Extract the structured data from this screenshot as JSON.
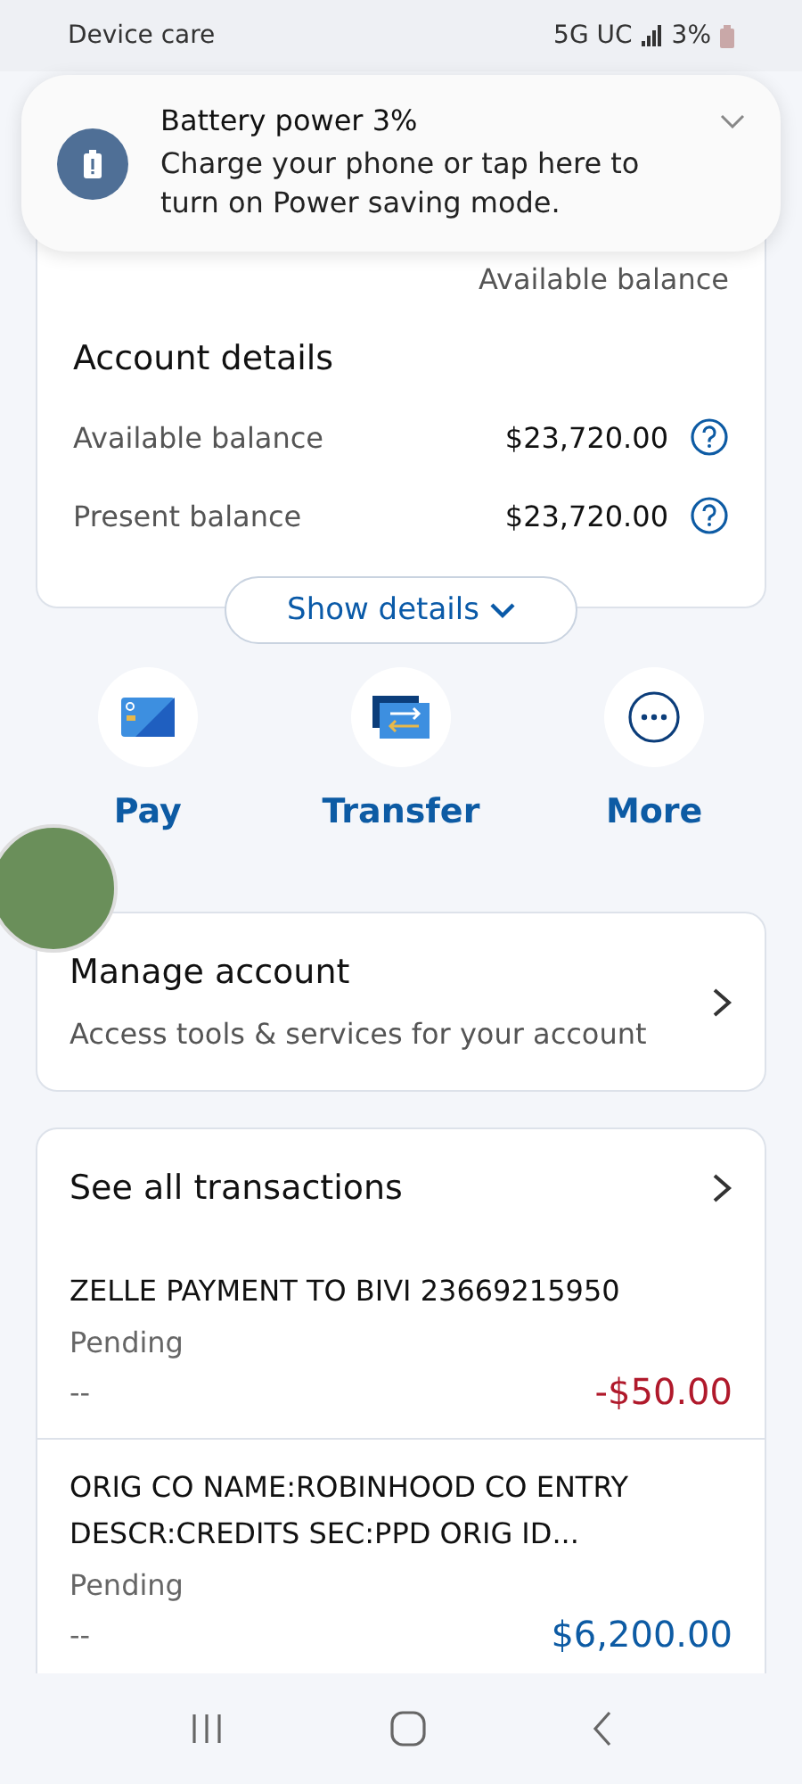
{
  "status_bar": {
    "left": "Device care",
    "network": "5G UC",
    "battery": "3%"
  },
  "notification": {
    "title": "Battery power 3%",
    "message": "Charge your phone or tap here to turn on Power saving mode."
  },
  "balance_caption": "Available balance",
  "account_details": {
    "title": "Account details",
    "rows": [
      {
        "label": "Available balance",
        "value": "$23,720.00"
      },
      {
        "label": "Present balance",
        "value": "$23,720.00"
      }
    ],
    "toggle": "Show details"
  },
  "actions": [
    {
      "kind": "pay",
      "label": "Pay"
    },
    {
      "kind": "transfer",
      "label": "Transfer"
    },
    {
      "kind": "more",
      "label": "More"
    }
  ],
  "manage": {
    "title": "Manage account",
    "subtitle": "Access tools & services for your account"
  },
  "transactions": {
    "title": "See all transactions",
    "items": [
      {
        "description": "ZELLE PAYMENT TO BIVI 23669215950",
        "status": "Pending",
        "date": "--",
        "amount": "-$50.00",
        "kind": "debit"
      },
      {
        "description": "ORIG CO NAME:ROBINHOOD CO ENTRY DESCR:CREDITS SEC:PPD ORIG ID...",
        "status": "Pending",
        "date": "--",
        "amount": "$6,200.00",
        "kind": "credit"
      }
    ]
  }
}
